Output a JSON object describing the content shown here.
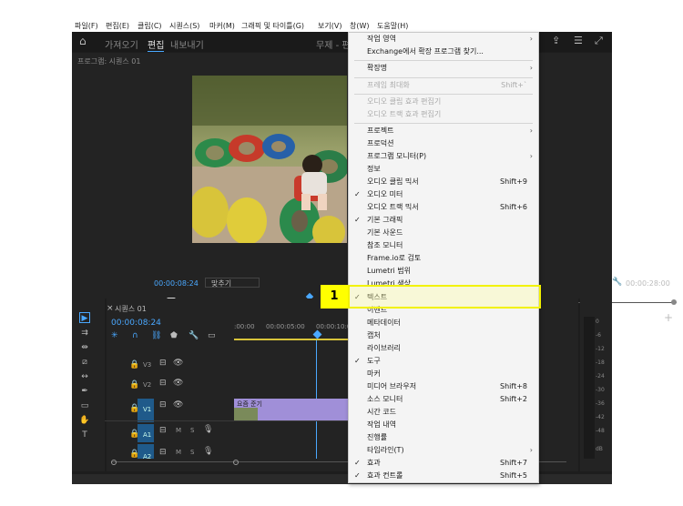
{
  "menubar": [
    "파일(F)",
    "편집(E)",
    "클립(C)",
    "시퀀스(S)",
    "마커(M)",
    "그래픽 및 타이틀(G)",
    "보기(V)",
    "창(W)",
    "도움말(H)"
  ],
  "workspace_tabs": {
    "learn": "가져오기",
    "edit": "편집",
    "export": "내보내기",
    "title": "무제 - 편"
  },
  "program_monitor": {
    "title": "프로그램: 시퀀스 01",
    "timecode": "00:00:08:24",
    "fit": "맞추기",
    "duration": "00:00:28:00"
  },
  "timeline": {
    "title": "시퀀스 01",
    "timecode": "00:00:08:24",
    "ruler": [
      ":00:00",
      "00:00:05:00",
      "00:00:10:0"
    ],
    "tracks": [
      "V3",
      "V2",
      "V1",
      "A1",
      "A2"
    ],
    "clip_label": "요즘 준기"
  },
  "meter_ticks": [
    "0",
    "-6",
    "-12",
    "-18",
    "-24",
    "-30",
    "-36",
    "-42",
    "-48",
    "dB"
  ],
  "menu": {
    "items": [
      {
        "label": "작업 영역",
        "shortcut": "",
        "arrow": "›",
        "check": false,
        "disabled": false
      },
      {
        "label": "Exchange에서 확장 프로그램 찾기...",
        "shortcut": "",
        "arrow": "",
        "check": false,
        "disabled": false
      },
      {
        "label": "확장명",
        "shortcut": "",
        "arrow": "›",
        "check": false,
        "disabled": false
      },
      {
        "label": "프레임 최대화",
        "shortcut": "Shift+`",
        "arrow": "",
        "check": false,
        "disabled": true
      },
      {
        "label": "오디오 클립 효과 편집기",
        "shortcut": "",
        "arrow": "",
        "check": false,
        "disabled": true
      },
      {
        "label": "오디오 트랙 효과 편집기",
        "shortcut": "",
        "arrow": "",
        "check": false,
        "disabled": true
      },
      {
        "label": "프로젝트",
        "shortcut": "",
        "arrow": "›",
        "check": false,
        "disabled": false
      },
      {
        "label": "프로덕션",
        "shortcut": "",
        "arrow": "",
        "check": false,
        "disabled": false
      },
      {
        "label": "프로그램 모니터(P)",
        "shortcut": "",
        "arrow": "›",
        "check": false,
        "disabled": false
      },
      {
        "label": "정보",
        "shortcut": "",
        "arrow": "",
        "check": false,
        "disabled": false
      },
      {
        "label": "오디오 클립 믹서",
        "shortcut": "Shift+9",
        "arrow": "",
        "check": false,
        "disabled": false
      },
      {
        "label": "오디오 미터",
        "shortcut": "",
        "arrow": "",
        "check": true,
        "disabled": false
      },
      {
        "label": "오디오 트랙 믹서",
        "shortcut": "Shift+6",
        "arrow": "",
        "check": false,
        "disabled": false
      },
      {
        "label": "기본 그래픽",
        "shortcut": "",
        "arrow": "",
        "check": true,
        "disabled": false
      },
      {
        "label": "기본 사운드",
        "shortcut": "",
        "arrow": "",
        "check": false,
        "disabled": false
      },
      {
        "label": "참조 모니터",
        "shortcut": "",
        "arrow": "",
        "check": false,
        "disabled": false
      },
      {
        "label": "Frame.io로 검토",
        "shortcut": "",
        "arrow": "",
        "check": false,
        "disabled": false
      },
      {
        "label": "Lumetri 범위",
        "shortcut": "",
        "arrow": "",
        "check": false,
        "disabled": false
      },
      {
        "label": "Lumetri 색상",
        "shortcut": "",
        "arrow": "",
        "check": false,
        "disabled": false
      },
      {
        "label": "텍스트",
        "shortcut": "",
        "arrow": "",
        "check": true,
        "disabled": false
      },
      {
        "label": "이벤트",
        "shortcut": "",
        "arrow": "",
        "check": false,
        "disabled": false
      },
      {
        "label": "메타데이터",
        "shortcut": "",
        "arrow": "",
        "check": false,
        "disabled": false
      },
      {
        "label": "캡처",
        "shortcut": "",
        "arrow": "",
        "check": false,
        "disabled": false
      },
      {
        "label": "라이브러리",
        "shortcut": "",
        "arrow": "",
        "check": false,
        "disabled": false
      },
      {
        "label": "도구",
        "shortcut": "",
        "arrow": "",
        "check": true,
        "disabled": false
      },
      {
        "label": "마커",
        "shortcut": "",
        "arrow": "",
        "check": false,
        "disabled": false
      },
      {
        "label": "미디어 브라우저",
        "shortcut": "Shift+8",
        "arrow": "",
        "check": false,
        "disabled": false
      },
      {
        "label": "소스 모니터",
        "shortcut": "Shift+2",
        "arrow": "",
        "check": false,
        "disabled": false
      },
      {
        "label": "시간 코드",
        "shortcut": "",
        "arrow": "",
        "check": false,
        "disabled": false
      },
      {
        "label": "작업 내역",
        "shortcut": "",
        "arrow": "",
        "check": false,
        "disabled": false
      },
      {
        "label": "진행률",
        "shortcut": "",
        "arrow": "",
        "check": false,
        "disabled": false
      },
      {
        "label": "타임라인(T)",
        "shortcut": "",
        "arrow": "›",
        "check": false,
        "disabled": false
      },
      {
        "label": "효과",
        "shortcut": "Shift+7",
        "arrow": "",
        "check": true,
        "disabled": false
      },
      {
        "label": "효과 컨트롤",
        "shortcut": "Shift+5",
        "arrow": "",
        "check": true,
        "disabled": false
      }
    ]
  },
  "callout": {
    "number": "1"
  },
  "colors": {
    "accent": "#4aa8ff",
    "highlight": "#ffff00",
    "clip": "#a08fd8",
    "track_blue": "#1f5a8a"
  }
}
